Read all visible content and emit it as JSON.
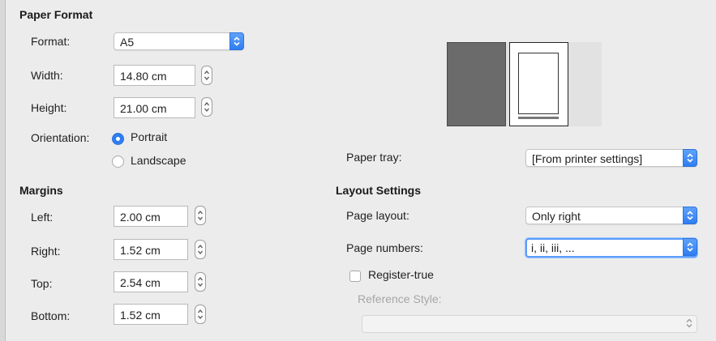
{
  "paper_format": {
    "heading": "Paper Format",
    "format": {
      "label": "Format:",
      "value": "A5"
    },
    "width": {
      "label": "Width:",
      "value": "14.80 cm"
    },
    "height": {
      "label": "Height:",
      "value": "21.00 cm"
    },
    "orientation": {
      "label": "Orientation:",
      "options": [
        {
          "label": "Portrait",
          "selected": true
        },
        {
          "label": "Landscape",
          "selected": false
        }
      ]
    },
    "paper_tray": {
      "label": "Paper tray:",
      "value": "[From printer settings]"
    }
  },
  "margins": {
    "heading": "Margins",
    "left": {
      "label": "Left:",
      "value": "2.00 cm"
    },
    "right": {
      "label": "Right:",
      "value": "1.52 cm"
    },
    "top": {
      "label": "Top:",
      "value": "2.54 cm"
    },
    "bottom": {
      "label": "Bottom:",
      "value": "1.52 cm"
    }
  },
  "layout_settings": {
    "heading": "Layout Settings",
    "page_layout": {
      "label": "Page layout:",
      "value": "Only right"
    },
    "page_numbers": {
      "label": "Page numbers:",
      "value": "i, ii, iii, ..."
    },
    "register_true": {
      "label": "Register-true",
      "checked": false
    },
    "reference_style": {
      "label": "Reference Style:",
      "value": ""
    }
  },
  "colors": {
    "accent": "#2f7df1",
    "preview_left_page": "#6b6b6b",
    "background": "#ececec"
  }
}
